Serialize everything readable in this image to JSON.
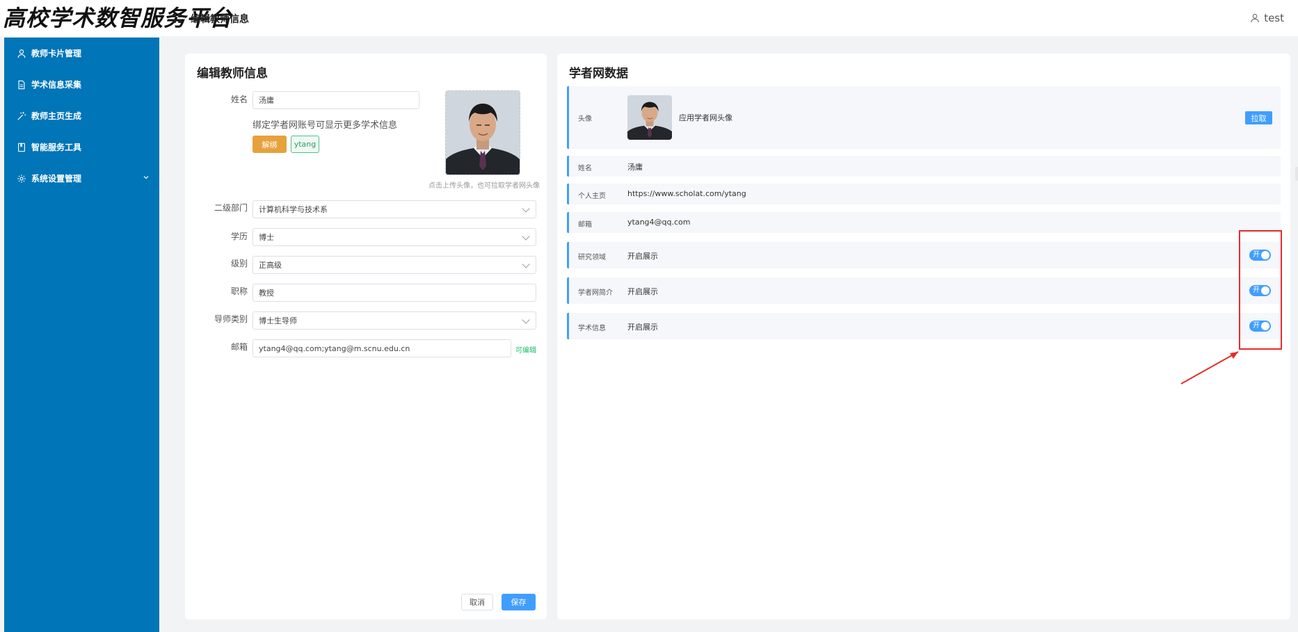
{
  "header": {
    "logo_text": "高校学术数智服务平台",
    "page_title": "编辑教师信息",
    "user_name": "test"
  },
  "sidebar": {
    "items": [
      {
        "label": "教师卡片管理",
        "icon": "user-icon"
      },
      {
        "label": "学术信息采集",
        "icon": "document-icon"
      },
      {
        "label": "教师主页生成",
        "icon": "magic-wand-icon"
      },
      {
        "label": "智能服务工具",
        "icon": "book-icon"
      },
      {
        "label": "系统设置管理",
        "icon": "gear-icon",
        "expandable": true
      }
    ]
  },
  "left_panel": {
    "title": "编辑教师信息",
    "name_label": "姓名",
    "name_value": "汤庸",
    "bind_hint": "绑定学者网账号可显示更多学术信息",
    "unbind_label": "解绑",
    "account_tag": "ytang",
    "upload_tip": "点击上传头像，也可拉取学者网头像",
    "fields": {
      "department": {
        "label": "二级部门",
        "value": "计算机科学与技术系"
      },
      "education": {
        "label": "学历",
        "value": "博士"
      },
      "level": {
        "label": "级别",
        "value": "正高级"
      },
      "title": {
        "label": "职称",
        "value": "教授"
      },
      "advisor_type": {
        "label": "导师类别",
        "value": "博士生导师"
      },
      "email": {
        "label": "邮箱",
        "value": "ytang4@qq.com;ytang@m.scnu.edu.cn",
        "editable_tag": "可编辑"
      }
    },
    "cancel_label": "取消",
    "save_label": "保存"
  },
  "right_panel": {
    "title": "学者网数据",
    "avatar_row": {
      "label": "头像",
      "value": "应用学者网头像",
      "button": "拉取"
    },
    "name_row": {
      "label": "姓名",
      "value": "汤庸"
    },
    "homepage_row": {
      "label": "个人主页",
      "value": "https://www.scholat.com/ytang"
    },
    "email_row": {
      "label": "邮箱",
      "value": "ytang4@qq.com"
    },
    "toggle_rows": [
      {
        "label": "研究领域",
        "value": "开启展示",
        "switch_text": "开",
        "on": true
      },
      {
        "label": "学者网简介",
        "value": "开启展示",
        "switch_text": "开",
        "on": true
      },
      {
        "label": "学术信息",
        "value": "开启展示",
        "switch_text": "开",
        "on": true
      }
    ]
  },
  "colors": {
    "sidebar": "#0075b7",
    "primary": "#409eff",
    "warning": "#e6a23c",
    "success": "#19be6b",
    "annotation": "#e52b2b"
  }
}
